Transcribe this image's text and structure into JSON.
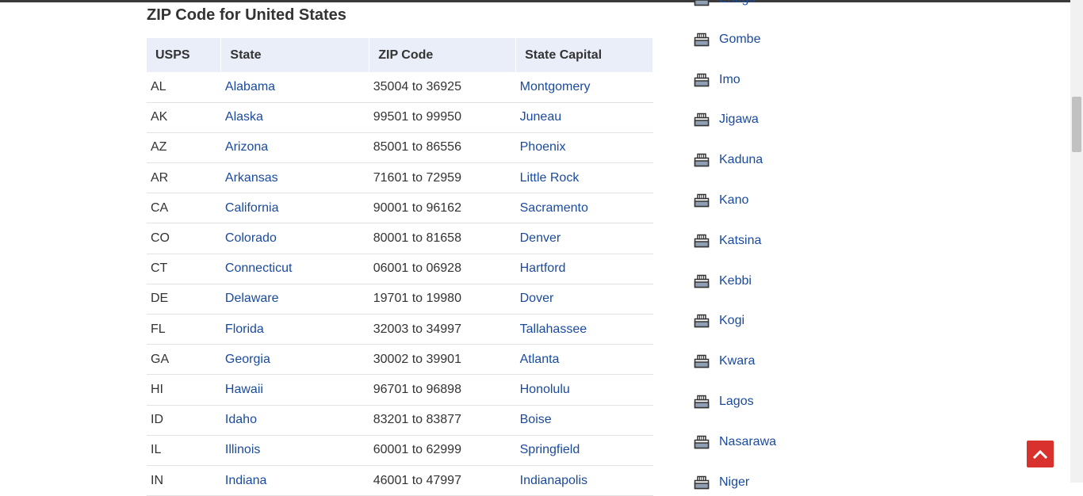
{
  "heading": "ZIP Code for United States",
  "table": {
    "headers": [
      "USPS",
      "State",
      "ZIP Code",
      "State Capital"
    ],
    "rows": [
      [
        "AL",
        "Alabama",
        "35004 to 36925",
        "Montgomery"
      ],
      [
        "AK",
        "Alaska",
        "99501 to 99950",
        "Juneau"
      ],
      [
        "AZ",
        "Arizona",
        "85001 to 86556",
        "Phoenix"
      ],
      [
        "AR",
        "Arkansas",
        "71601 to 72959",
        "Little Rock"
      ],
      [
        "CA",
        "California",
        "90001 to 96162",
        "Sacramento"
      ],
      [
        "CO",
        "Colorado",
        "80001 to 81658",
        "Denver"
      ],
      [
        "CT",
        "Connecticut",
        "06001 to 06928",
        "Hartford"
      ],
      [
        "DE",
        "Delaware",
        "19701 to 19980",
        "Dover"
      ],
      [
        "FL",
        "Florida",
        "32003 to 34997",
        "Tallahassee"
      ],
      [
        "GA",
        "Georgia",
        "30002 to 39901",
        "Atlanta"
      ],
      [
        "HI",
        "Hawaii",
        "96701 to 96898",
        "Honolulu"
      ],
      [
        "ID",
        "Idaho",
        "83201 to 83877",
        "Boise"
      ],
      [
        "IL",
        "Illinois",
        "60001 to 62999",
        "Springfield"
      ],
      [
        "IN",
        "Indiana",
        "46001 to 47997",
        "Indianapolis"
      ]
    ]
  },
  "sidebar": {
    "icon": "building-icon",
    "items": [
      "Enugu",
      "Gombe",
      "Imo",
      "Jigawa",
      "Kaduna",
      "Kano",
      "Katsina",
      "Kebbi",
      "Kogi",
      "Kwara",
      "Lagos",
      "Nasarawa",
      "Niger"
    ]
  },
  "colors": {
    "link": "#1a4a9e",
    "header_bg": "#e9eef8",
    "back_to_top": "#d9312d"
  },
  "back_to_top_icon": "chevron-up-icon"
}
